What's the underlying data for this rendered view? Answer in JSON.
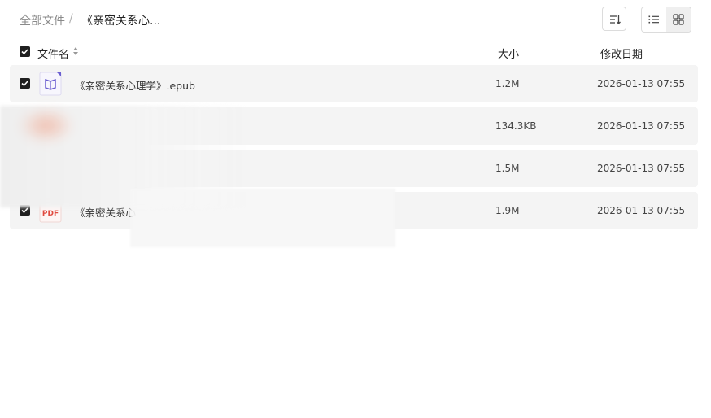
{
  "breadcrumb": {
    "root": "全部文件",
    "separator": "/",
    "current": "《亲密关系心..."
  },
  "toolbar": {
    "sort_icon": "sort-lines-icon",
    "list_view_icon": "list-view-icon",
    "grid_view_icon": "grid-view-icon"
  },
  "table": {
    "headers": {
      "name": "文件名",
      "size": "大小",
      "date": "修改日期"
    },
    "rows": [
      {
        "name": "《亲密关系心理学》.epub",
        "size": "1.2M",
        "date": "2026-01-13 07:55",
        "icon": "epub-book-icon",
        "checked": true
      },
      {
        "name": "",
        "size": "134.3KB",
        "date": "2026-01-13 07:55",
        "icon": "",
        "checked": false
      },
      {
        "name": "",
        "size": "1.5M",
        "date": "2026-01-13 07:55",
        "icon": "",
        "checked": false
      },
      {
        "name": "《亲密关系心",
        "size": "1.9M",
        "date": "2026-01-13 07:55",
        "icon": "pdf-file-icon",
        "icon_text": "PDF",
        "checked": true
      }
    ]
  },
  "colors": {
    "row_bg": "#f4f4f4",
    "checkbox": "#1f1f1f",
    "epub_icon": "#6b5fd0",
    "pdf_icon": "#e04a3f"
  }
}
